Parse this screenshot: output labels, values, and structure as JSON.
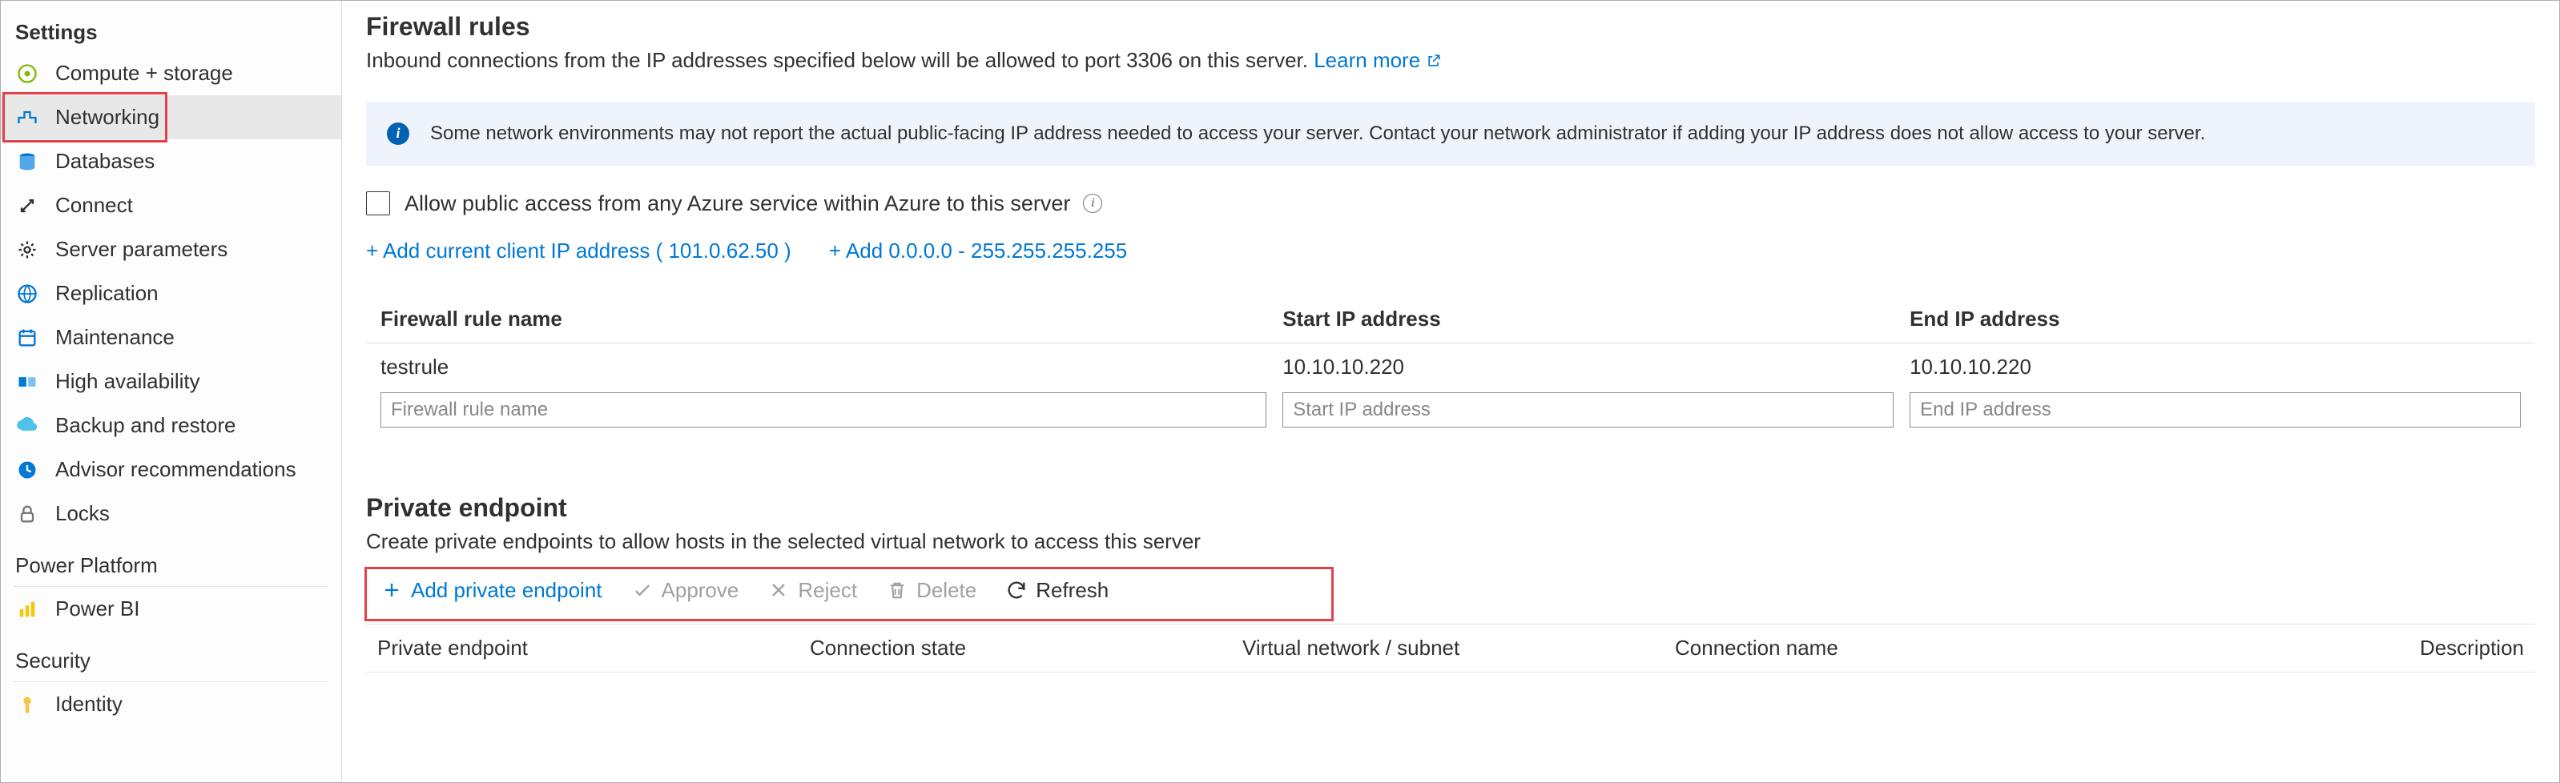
{
  "sidebar": {
    "section_settings": "Settings",
    "section_power": "Power Platform",
    "section_security": "Security",
    "items": [
      {
        "label": "Compute + storage"
      },
      {
        "label": "Networking"
      },
      {
        "label": "Databases"
      },
      {
        "label": "Connect"
      },
      {
        "label": "Server parameters"
      },
      {
        "label": "Replication"
      },
      {
        "label": "Maintenance"
      },
      {
        "label": "High availability"
      },
      {
        "label": "Backup and restore"
      },
      {
        "label": "Advisor recommendations"
      },
      {
        "label": "Locks"
      }
    ],
    "power_items": [
      {
        "label": "Power BI"
      }
    ],
    "security_items": [
      {
        "label": "Identity"
      }
    ]
  },
  "firewall": {
    "heading": "Firewall rules",
    "desc_pre": "Inbound connections from the IP addresses specified below will be allowed to port 3306 on this server. ",
    "learn_more": "Learn more",
    "info_text": "Some network environments may not report the actual public-facing IP address needed to access your server.  Contact your network administrator if adding your IP address does not allow access to your server.",
    "allow_azure_label": "Allow public access from any Azure service within Azure to this server",
    "add_client_ip": "+ Add current client IP address ( 101.0.62.50 )",
    "add_range": "+ Add 0.0.0.0 - 255.255.255.255",
    "cols": {
      "name": "Firewall rule name",
      "start": "Start IP address",
      "end": "End IP address"
    },
    "rows": [
      {
        "name": "testrule",
        "start": "10.10.10.220",
        "end": "10.10.10.220"
      }
    ],
    "placeholders": {
      "name": "Firewall rule name",
      "start": "Start IP address",
      "end": "End IP address"
    }
  },
  "pe": {
    "heading": "Private endpoint",
    "desc": "Create private endpoints to allow hosts in the selected virtual network to access this server",
    "btn_add": "Add private endpoint",
    "btn_approve": "Approve",
    "btn_reject": "Reject",
    "btn_delete": "Delete",
    "btn_refresh": "Refresh",
    "cols": {
      "ep": "Private endpoint",
      "state": "Connection state",
      "vnet": "Virtual network / subnet",
      "cname": "Connection name",
      "desc": "Description"
    }
  }
}
